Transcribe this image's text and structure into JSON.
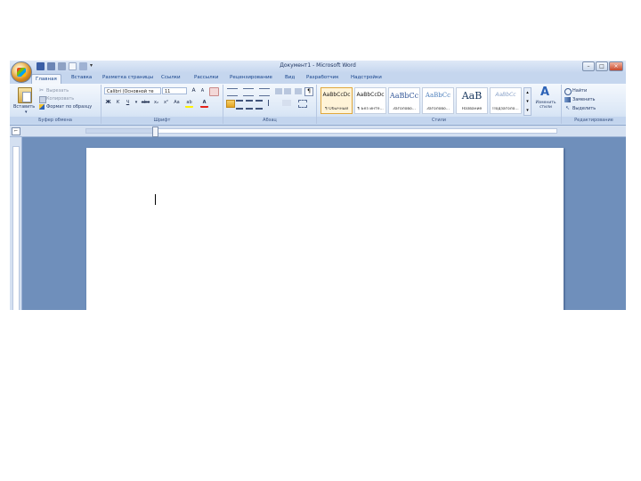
{
  "window": {
    "title": "Документ1 - Microsoft Word",
    "controls": [
      "–",
      "□",
      "×"
    ]
  },
  "tabs": [
    "Главная",
    "Вставка",
    "Разметка страницы",
    "Ссылки",
    "Рассылки",
    "Рецензирование",
    "Вид",
    "Разработчик",
    "Надстройки"
  ],
  "active_tab": "Главная",
  "clipboard": {
    "paste": "Вставить",
    "cut": "Вырезать",
    "copy": "Копировать",
    "format_painter": "Формат по образцу",
    "label": "Буфер обмена"
  },
  "font": {
    "name": "Calibri (Основной те",
    "size": "11",
    "label": "Шрифт",
    "bold": "Ж",
    "italic": "К",
    "underline": "Ч",
    "strike": "abe",
    "sub": "x₂",
    "sup": "x²",
    "case": "Aa",
    "grow": "A",
    "shrink": "A",
    "highlight": "ab",
    "color": "A"
  },
  "paragraph": {
    "label": "Абзац"
  },
  "styles": {
    "label": "Стили",
    "items": [
      {
        "sample": "AaBbCcDc",
        "name": "¶ Обычный"
      },
      {
        "sample": "AaBbCcDc",
        "name": "¶ Без инте..."
      },
      {
        "sample": "AaBbCc",
        "name": "Заголово..."
      },
      {
        "sample": "AaBbCc",
        "name": "Заголово..."
      },
      {
        "sample": "AaB",
        "name": "Название"
      },
      {
        "sample": "AaBbCc",
        "name": "Подзаголо..."
      }
    ],
    "change_styles": "Изменить стили"
  },
  "editing": {
    "find": "Найти",
    "replace": "Заменить",
    "select": "Выделить",
    "label": "Редактирование"
  },
  "colors": {
    "accent": "#15428b",
    "ribbon_bg": "#dbe7f6",
    "workspace": "#6f8fbb",
    "highlight": "#fff200",
    "font_color": "#e4221b"
  }
}
